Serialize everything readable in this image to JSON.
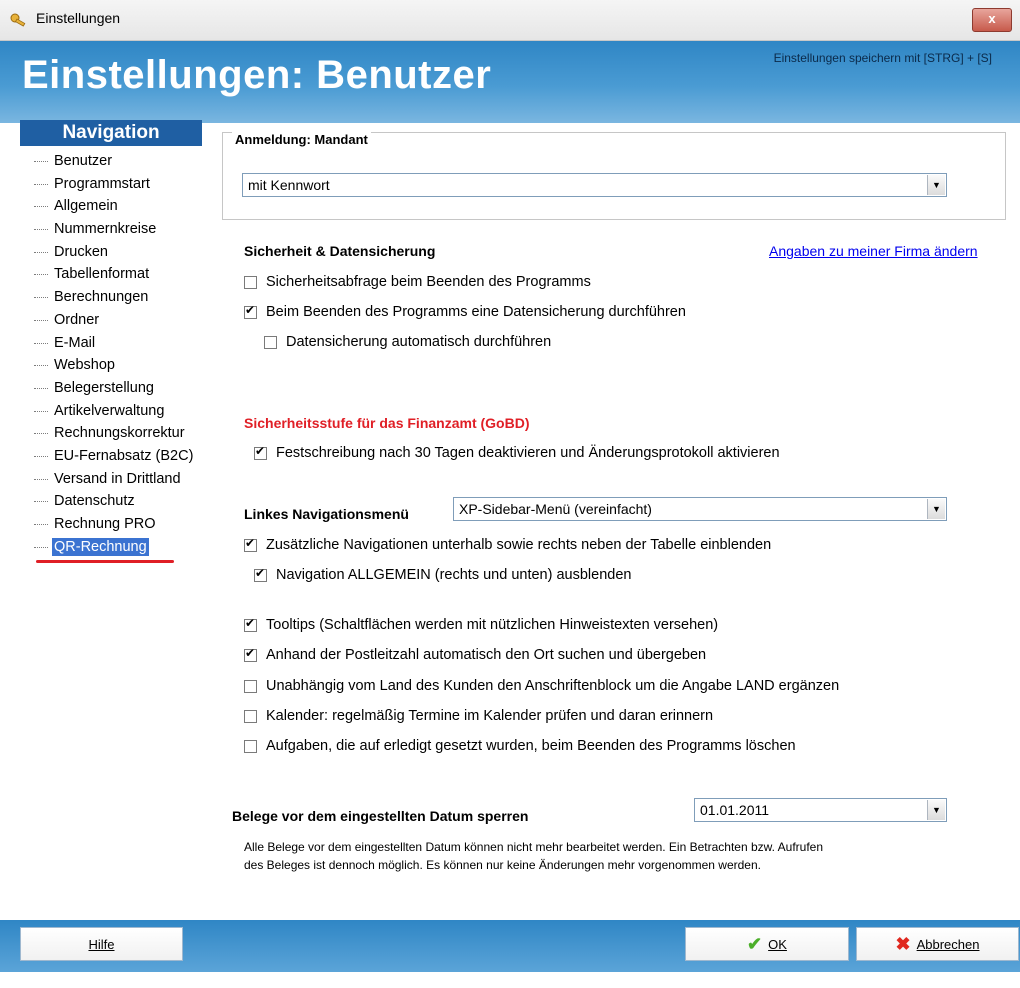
{
  "window": {
    "title": "Einstellungen",
    "close_label": "x"
  },
  "header": {
    "title": "Einstellungen: Benutzer",
    "save_hint": "Einstellungen speichern mit  [STRG] + [S]"
  },
  "nav": {
    "header": "Navigation",
    "items": [
      {
        "label": "Benutzer"
      },
      {
        "label": "Programmstart"
      },
      {
        "label": "Allgemein"
      },
      {
        "label": "Nummernkreise"
      },
      {
        "label": "Drucken"
      },
      {
        "label": "Tabellenformat"
      },
      {
        "label": "Berechnungen"
      },
      {
        "label": "Ordner"
      },
      {
        "label": "E-Mail"
      },
      {
        "label": "Webshop"
      },
      {
        "label": "Belegerstellung"
      },
      {
        "label": "Artikelverwaltung"
      },
      {
        "label": "Rechnungskorrektur"
      },
      {
        "label": "EU-Fernabsatz (B2C)"
      },
      {
        "label": "Versand in Drittland"
      },
      {
        "label": "Datenschutz"
      },
      {
        "label": "Rechnung PRO"
      },
      {
        "label": "QR-Rechnung"
      }
    ],
    "selected": "QR-Rechnung"
  },
  "login": {
    "legend": "Anmeldung: Mandant",
    "value": "mit Kennwort"
  },
  "security": {
    "title": "Sicherheit & Datensicherung",
    "link": "Angaben zu meiner Firma ändern",
    "options": [
      {
        "label": "Sicherheitsabfrage beim Beenden des Programms",
        "checked": false
      },
      {
        "label": "Beim Beenden des Programms eine Datensicherung durchführen",
        "checked": true
      },
      {
        "label": "Datensicherung automatisch durchführen",
        "checked": false
      }
    ]
  },
  "gobd": {
    "title": "Sicherheitsstufe für das Finanzamt (GoBD)",
    "option": {
      "label": "Festschreibung nach 30 Tagen deaktivieren und Änderungsprotokoll aktivieren",
      "checked": true
    }
  },
  "navmenu": {
    "label": "Linkes Navigationsmenü",
    "value": "XP-Sidebar-Menü (vereinfacht)",
    "options": [
      {
        "label": "Zusätzliche Navigationen unterhalb sowie rechts neben der Tabelle einblenden",
        "checked": true
      },
      {
        "label": "Navigation ALLGEMEIN (rechts und unten) ausblenden",
        "checked": true
      }
    ]
  },
  "misc": {
    "options": [
      {
        "label": "Tooltips (Schaltflächen werden mit nützlichen Hinweistexten versehen)",
        "checked": true
      },
      {
        "label": "Anhand der Postleitzahl automatisch den Ort suchen und übergeben",
        "checked": true
      },
      {
        "label": "Unabhängig vom Land des Kunden den Anschriftenblock um die Angabe LAND ergänzen",
        "checked": false
      },
      {
        "label": "Kalender: regelmäßig Termine im Kalender prüfen und daran erinnern",
        "checked": false
      },
      {
        "label": "Aufgaben, die auf erledigt gesetzt wurden, beim Beenden des Programms löschen",
        "checked": false
      }
    ]
  },
  "lock": {
    "label": "Belege vor dem eingestellten Datum sperren",
    "value": "01.01.2011",
    "note_line1": "Alle Belege vor dem eingestellten Datum können nicht mehr bearbeitet werden. Ein Betrachten bzw. Aufrufen",
    "note_line2": "des Beleges ist dennoch möglich. Es können nur keine Änderungen mehr vorgenommen werden."
  },
  "footer": {
    "help": "Hilfe",
    "ok": "OK",
    "cancel": "Abbrechen"
  },
  "colors": {
    "header_blue": "#2f86c5",
    "nav_header": "#1f5fa3",
    "selected_bg": "#3b73d1",
    "gobd_red": "#e01f26",
    "link": "#0000ee"
  },
  "icons": {
    "app": "key-icon",
    "ok": "checkmark-icon",
    "cancel": "x-icon"
  }
}
